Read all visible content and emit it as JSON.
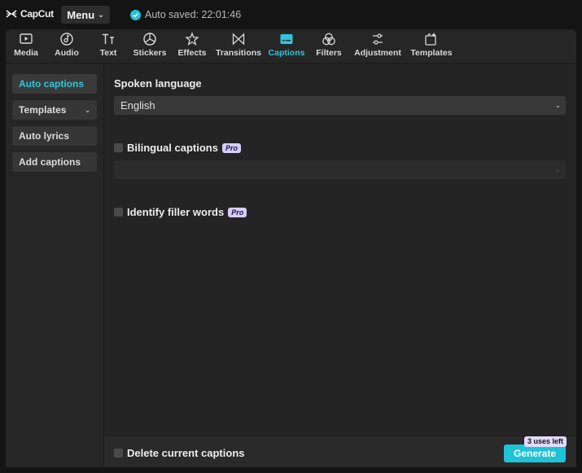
{
  "app": {
    "name": "CapCut",
    "menu_label": "Menu",
    "autosave_text": "Auto saved: 22:01:46"
  },
  "toolbar": {
    "tabs": [
      {
        "label": "Media",
        "icon": "media-icon"
      },
      {
        "label": "Audio",
        "icon": "audio-icon"
      },
      {
        "label": "Text",
        "icon": "text-icon"
      },
      {
        "label": "Stickers",
        "icon": "stickers-icon"
      },
      {
        "label": "Effects",
        "icon": "effects-icon"
      },
      {
        "label": "Transitions",
        "icon": "transitions-icon"
      },
      {
        "label": "Captions",
        "icon": "captions-icon",
        "active": true
      },
      {
        "label": "Filters",
        "icon": "filters-icon"
      },
      {
        "label": "Adjustment",
        "icon": "adjustment-icon"
      },
      {
        "label": "Templates",
        "icon": "templates-icon"
      }
    ]
  },
  "sidebar": {
    "items": [
      {
        "label": "Auto captions",
        "active": true
      },
      {
        "label": "Templates",
        "has_dropdown": true
      },
      {
        "label": "Auto lyrics"
      },
      {
        "label": "Add captions"
      }
    ]
  },
  "main": {
    "spoken_language": {
      "label": "Spoken language",
      "value": "English"
    },
    "bilingual": {
      "label": "Bilingual captions",
      "badge": "Pro",
      "checked": false,
      "select_value": ""
    },
    "filler": {
      "label": "Identify filler words",
      "badge": "Pro",
      "checked": false
    }
  },
  "footer": {
    "delete_label": "Delete current captions",
    "generate_label": "Generate",
    "uses_badge": "3 uses left"
  },
  "colors": {
    "accent": "#20c2d6",
    "pro_badge": "#d6ccff",
    "background": "#242424"
  }
}
